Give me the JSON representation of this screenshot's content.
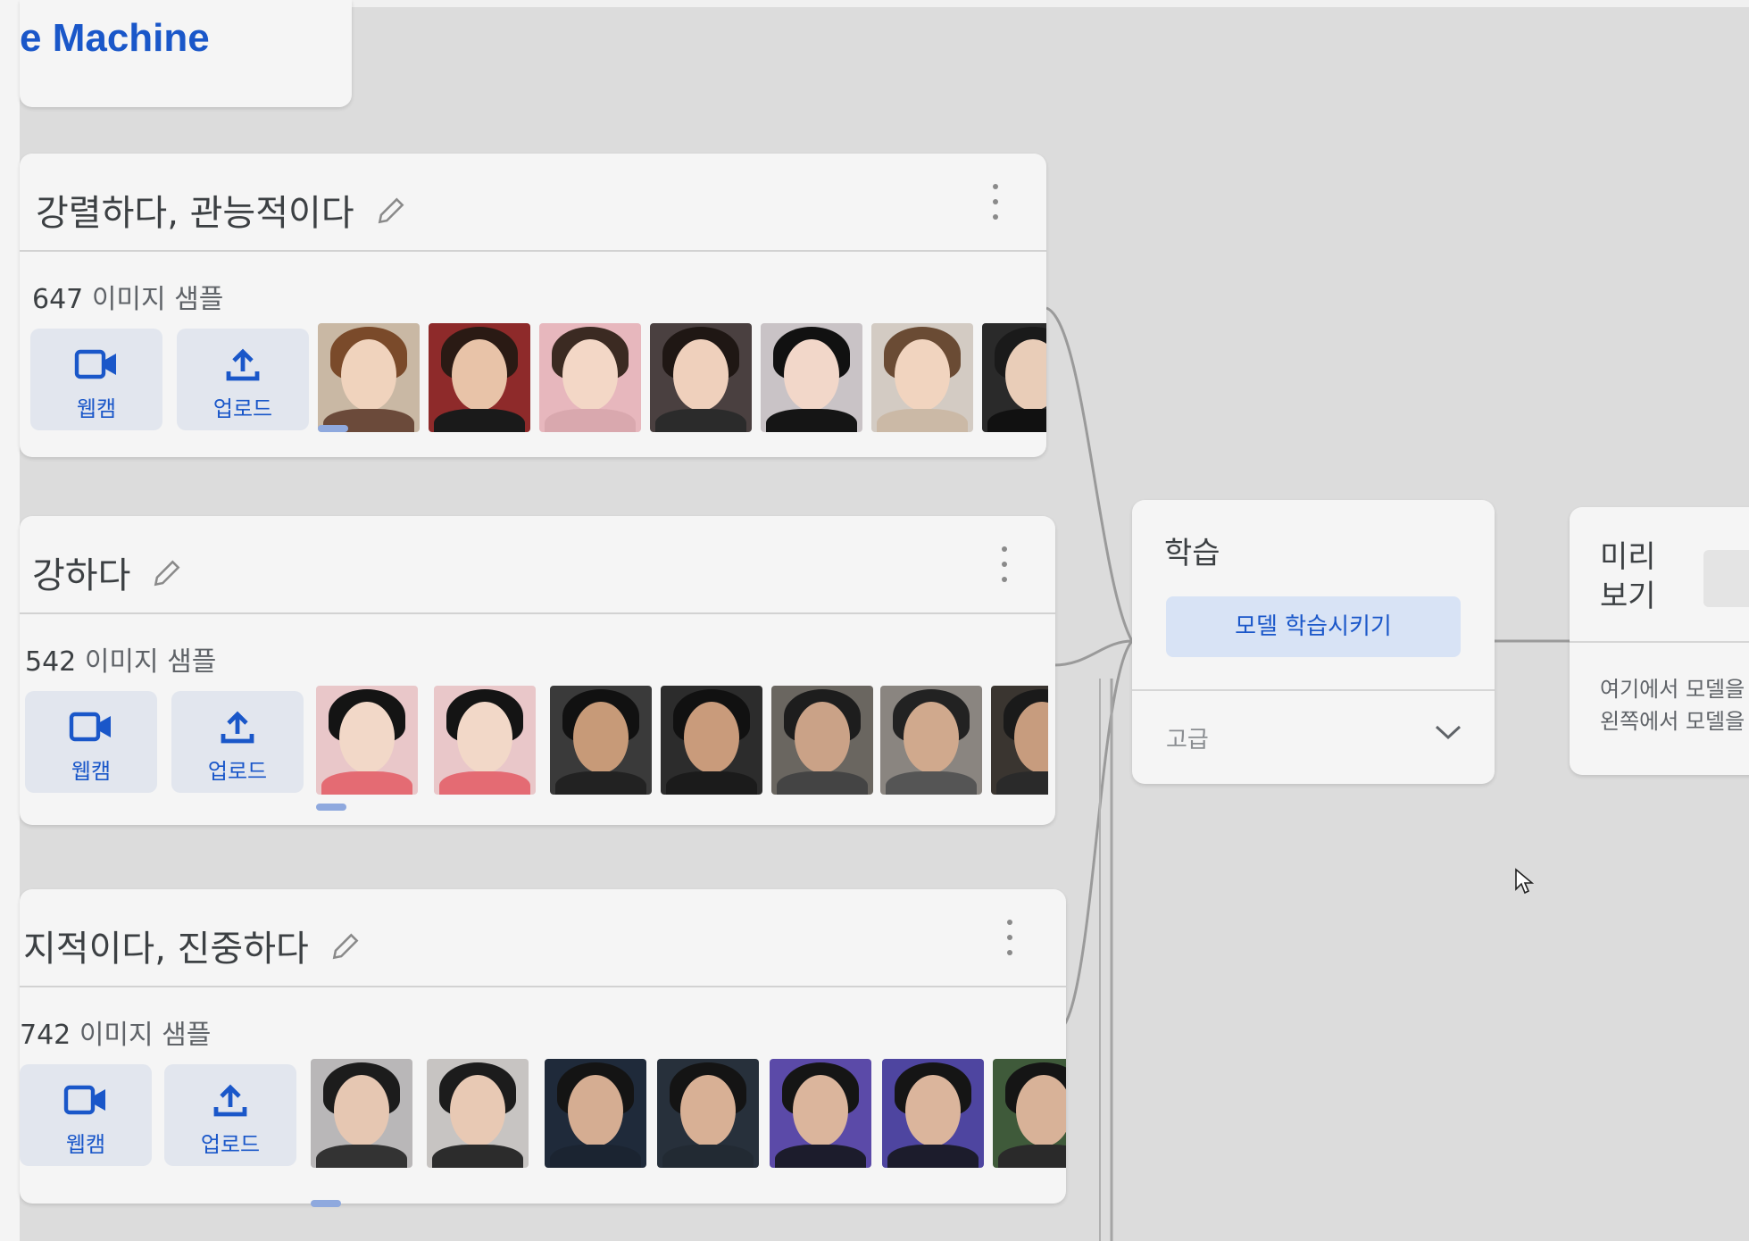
{
  "app": {
    "title_fragment": "e Machine"
  },
  "classes": [
    {
      "name": "강렬하다, 관능적이다",
      "count": "647",
      "count_suffix": "이미지 샘플",
      "webcam_label": "웹캠",
      "upload_label": "업로드"
    },
    {
      "name": "강하다",
      "count": "542",
      "count_suffix": "이미지 샘플",
      "webcam_label": "웹캠",
      "upload_label": "업로드"
    },
    {
      "name": "지적이다, 진중하다",
      "count": "742",
      "count_suffix": "이미지 샘플",
      "webcam_label": "웹캠",
      "upload_label": "업로드"
    }
  ],
  "training": {
    "title": "학습",
    "train_button": "모델 학습시키기",
    "advanced_label": "고급"
  },
  "preview": {
    "title": "미리 보기",
    "message_line1": "여기에서 모델을",
    "message_line2": "왼쪽에서 모델을"
  },
  "icons": [
    "pencil-icon",
    "more-vert-icon",
    "webcam-icon",
    "upload-icon",
    "chevron-down-icon",
    "cursor-icon"
  ],
  "colors": {
    "accent": "#1a57c9",
    "button_bg": "#e2e6ee",
    "train_button_bg": "#d8e3f5"
  }
}
